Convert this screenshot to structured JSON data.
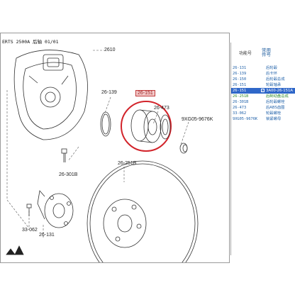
{
  "diagram": {
    "title": "ERTS 2500A 后轴 01/01",
    "callouts": {
      "c2610": "2610",
      "c26139": "26-139",
      "c26151": "26-151",
      "c26473": "26-473",
      "c9xg": "9XG05-9676K",
      "c26301b": "26-301B",
      "c26251b": "26-251B",
      "c26131": "26-131",
      "c33062": "33-062"
    }
  },
  "panel": {
    "header": {
      "function_label": "功能号",
      "common_line1": "常用",
      "common_line2": "件号"
    },
    "parts": [
      {
        "number": "26-131",
        "name": "后轮毂",
        "state": "normal"
      },
      {
        "number": "26-139",
        "name": "后卡环",
        "state": "normal"
      },
      {
        "number": "26-150",
        "name": "后轮毂总成",
        "state": "normal"
      },
      {
        "number": "26-151",
        "name": "轮毂轴承",
        "state": "normal"
      },
      {
        "number": "26-151",
        "name": "3A00-26-151A",
        "state": "selected"
      },
      {
        "number": "26-251B",
        "name": "后制动盘总成",
        "state": "green"
      },
      {
        "number": "26-301B",
        "name": "后轮毂螺栓",
        "state": "normal"
      },
      {
        "number": "26-473",
        "name": "后ABS齿圈",
        "state": "normal"
      },
      {
        "number": "33-062",
        "name": "轮毂螺栓",
        "state": "normal"
      },
      {
        "number": "9XG05-9676K",
        "name": "锁紧螺母",
        "state": "normal"
      }
    ]
  },
  "colors": {
    "highlight_circle": "#d2232a",
    "selected_row": "#2f67c9",
    "link_text": "#1d5fa8",
    "green_text": "#2b8a2b"
  }
}
